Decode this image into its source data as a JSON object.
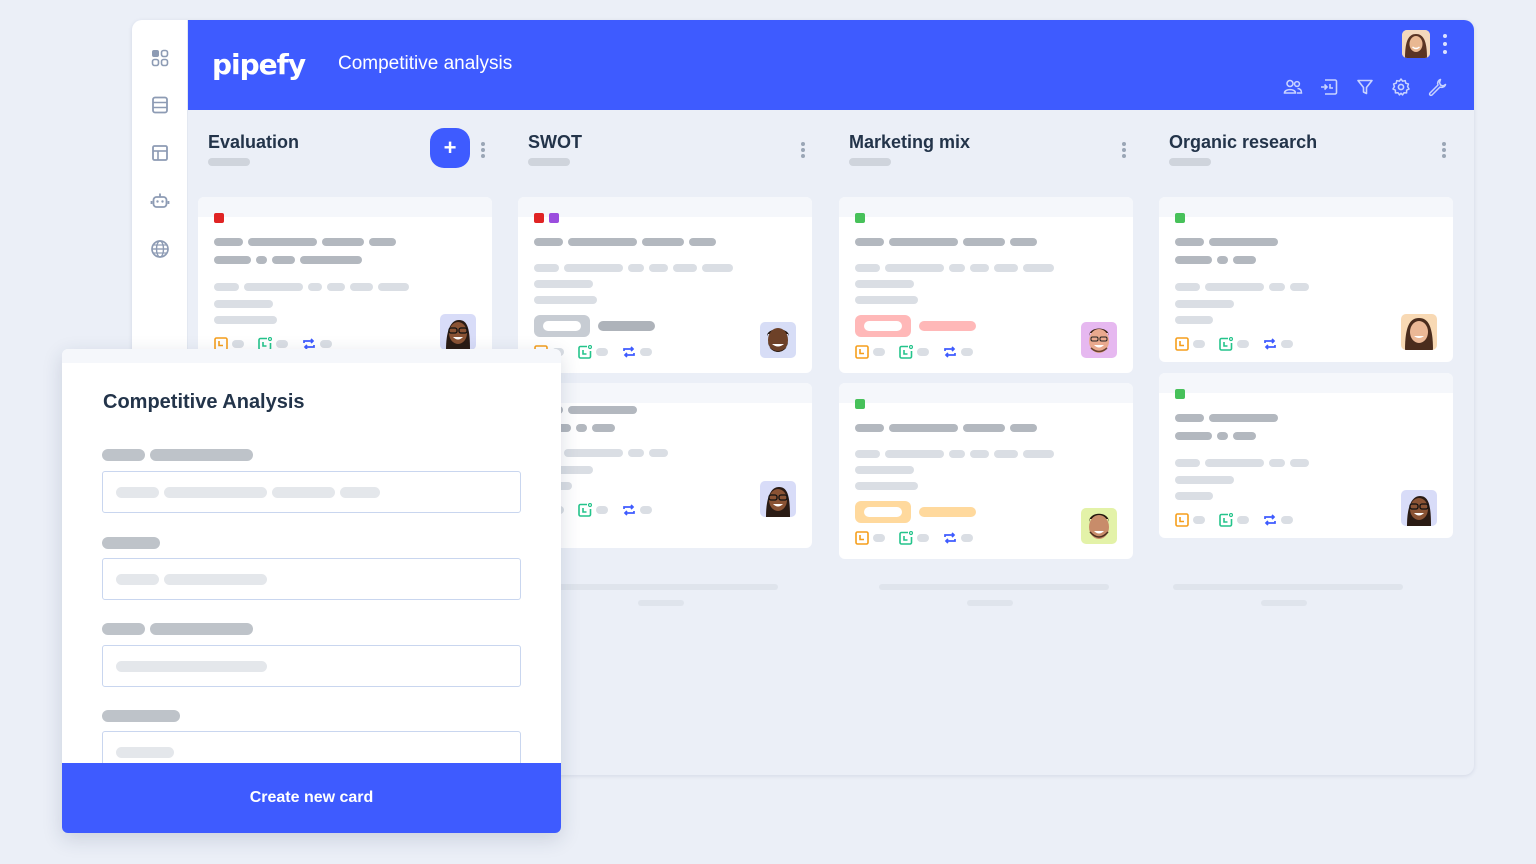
{
  "app": {
    "logo": "pipefy",
    "pipe_title": "Competitive analysis",
    "colors": {
      "brand": "#3e5bff",
      "background": "#ebeff7",
      "tag_red": "#e02424",
      "tag_purple": "#9b4dde",
      "tag_green": "#47c15a",
      "icon_orange": "#f59e1b",
      "icon_green": "#24c48b",
      "icon_blue": "#3e5bff"
    }
  },
  "rail": {
    "items": [
      {
        "icon": "apps-grid-icon"
      },
      {
        "icon": "database-icon"
      },
      {
        "icon": "layout-icon"
      },
      {
        "icon": "robot-icon"
      },
      {
        "icon": "globe-icon"
      }
    ]
  },
  "toolbar": {
    "icons": [
      "members-icon",
      "import-icon",
      "filter-icon",
      "settings-icon",
      "wrench-icon"
    ]
  },
  "columns": [
    {
      "title": "Evaluation",
      "has_add_button": true,
      "add_label": "+"
    },
    {
      "title": "SWOT"
    },
    {
      "title": "Marketing mix"
    },
    {
      "title": "Organic research"
    }
  ],
  "modal": {
    "title": "Competitive Analysis",
    "submit_label": "Create new card"
  }
}
